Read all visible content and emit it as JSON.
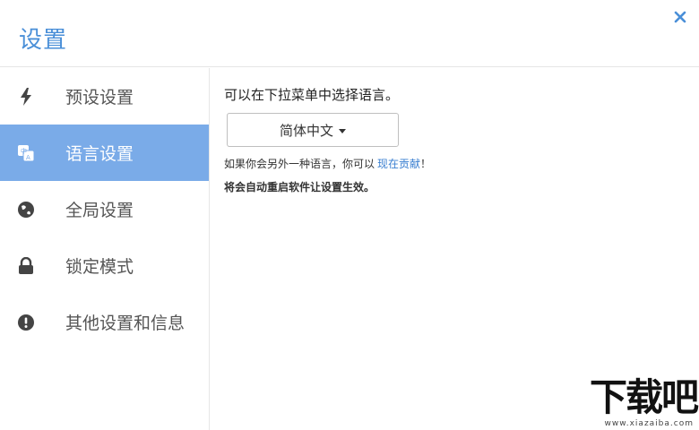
{
  "header": {
    "title": "设置"
  },
  "sidebar": {
    "items": [
      {
        "label": "预设设置",
        "icon": "lightning-icon",
        "active": false
      },
      {
        "label": "语言设置",
        "icon": "translate-icon",
        "active": true
      },
      {
        "label": "全局设置",
        "icon": "globe-icon",
        "active": false
      },
      {
        "label": "锁定模式",
        "icon": "lock-icon",
        "active": false
      },
      {
        "label": "其他设置和信息",
        "icon": "info-icon",
        "active": false
      }
    ]
  },
  "main": {
    "prompt": "可以在下拉菜单中选择语言。",
    "language_select": {
      "value": "简体中文"
    },
    "hint_text": "如果你会另外一种语言，你可以",
    "contribute_link": "现在贡献",
    "hint_suffix": "！",
    "restart_note": "将会自动重启软件让设置生效。"
  },
  "watermark": {
    "text": "下载吧",
    "url_text": "www.xiazaiba.com"
  },
  "colors": {
    "accent": "#4a8fd8",
    "active_bg": "#7aabe8",
    "link": "#3a7fd0"
  }
}
